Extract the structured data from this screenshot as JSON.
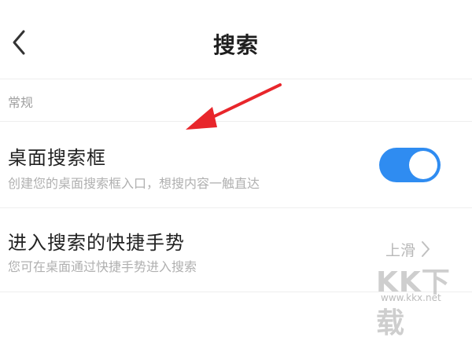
{
  "header": {
    "title": "搜索",
    "back_icon": "chevron-left-icon"
  },
  "section": {
    "label": "常规"
  },
  "rows": [
    {
      "title": "桌面搜索框",
      "subtitle": "创建您的桌面搜索框入口，想搜内容一触直达",
      "toggle_on": true
    },
    {
      "title": "进入搜索的快捷手势",
      "subtitle": "您可在桌面通过快捷手势进入搜索",
      "value": "上滑",
      "chevron_icon": "chevron-right-icon"
    }
  ],
  "annotation": {
    "icon": "red-arrow-icon",
    "color": "#e8262b"
  },
  "watermark": {
    "logo": "KK下载",
    "url": "www.kkx.net"
  },
  "colors": {
    "toggle_on": "#2f8cf1",
    "divider": "#eeeeee"
  }
}
